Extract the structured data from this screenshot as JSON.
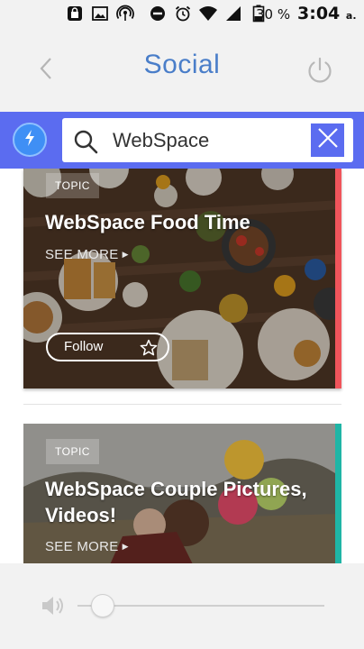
{
  "status_bar": {
    "battery": "30 %",
    "time": "3:04",
    "ampm": "a. m."
  },
  "header": {
    "title": "Social"
  },
  "search": {
    "value": "WebSpace"
  },
  "cards": [
    {
      "tag": "TOPIC",
      "title": "WebSpace Food Time",
      "see_more": "SEE MORE",
      "follow_label": "Follow",
      "accent_color": "#f0545b"
    },
    {
      "tag": "TOPIC",
      "title": "WebSpace Couple Pictures, Videos!",
      "see_more": "SEE MORE",
      "accent_color": "#1fb5a6"
    }
  ],
  "colors": {
    "brand": "#5b6cf0",
    "title": "#4a7ec9",
    "flash": "#3f8ff5"
  },
  "footer": {
    "volume_level": 0.11
  }
}
